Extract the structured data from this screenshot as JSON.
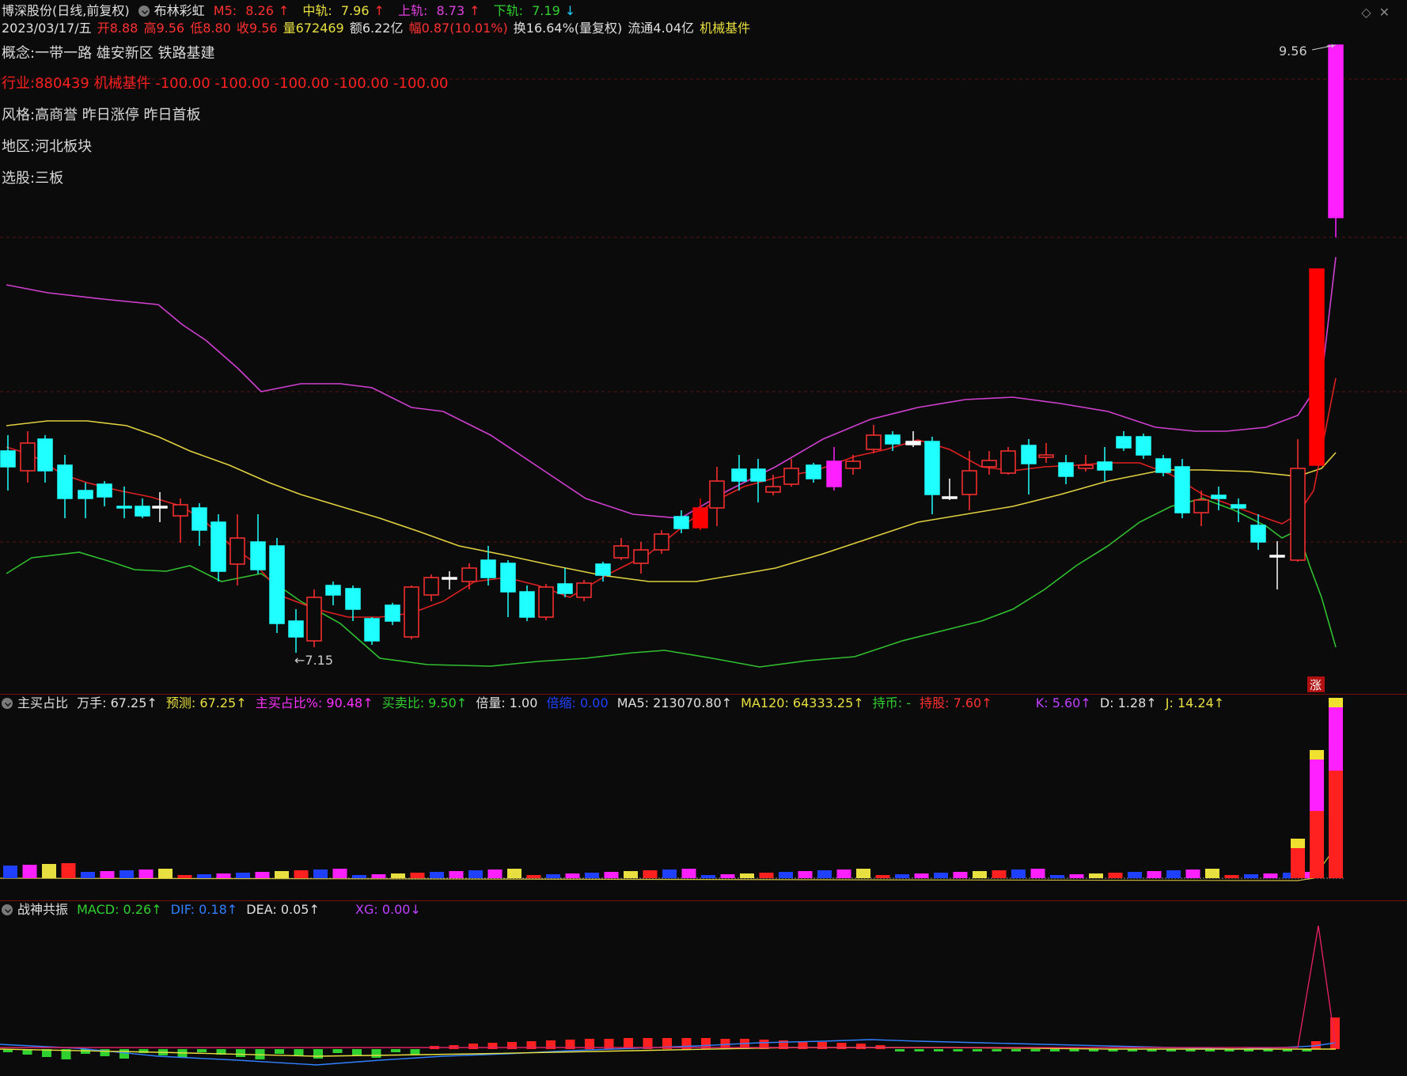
{
  "header": {
    "stock_title": "博深股份(日线,前复权)",
    "indicator_name": "布林彩虹",
    "m5": {
      "label": "M5:",
      "value": "8.26",
      "arrow": "↑"
    },
    "mid": {
      "label": "中轨:",
      "value": "7.96",
      "arrow": "↑"
    },
    "upper": {
      "label": "上轨:",
      "value": "8.73",
      "arrow": "↑"
    },
    "lower": {
      "label": "下轨:",
      "value": "7.19",
      "arrow": "↓"
    }
  },
  "quote_line": {
    "date": "2023/03/17/五",
    "open": "开8.88",
    "high": "高9.56",
    "low": "低8.80",
    "close": "收9.56",
    "volume": "量672469",
    "amount": "额6.22亿",
    "change": "幅0.87(10.01%)",
    "turnover": "换16.64%(量复权)",
    "float_cap": "流通4.04亿",
    "industry_tag": "机械基件"
  },
  "info": {
    "concept": {
      "label": "概念:",
      "value": "一带一路 雄安新区 铁路基建"
    },
    "industry": {
      "label": "行业:",
      "value": "880439 机械基件 -100.00 -100.00 -100.00 -100.00 -100.00"
    },
    "style": {
      "label": "风格:",
      "value": "高商誉 昨日涨停 昨日首板"
    },
    "region": {
      "label": "地区:",
      "value": "河北板块"
    },
    "pick": {
      "label": "选股:",
      "value": "三板"
    }
  },
  "price_labels": {
    "high_mark": "9.56",
    "low_mark": "←7.15",
    "limit_badge": "涨"
  },
  "panel2": {
    "title": "主买占比",
    "wanshou": "万手: 67.25↑",
    "forecast": "预测: 67.25↑",
    "main_buy_pct": "主买占比%: 90.48↑",
    "buy_sell_ratio": "买卖比: 9.50↑",
    "multiple": "倍量: 1.00",
    "shrink": "倍缩: 0.00",
    "ma5": "MA5: 213070.80↑",
    "ma120": "MA120: 64333.25↑",
    "hold_coin": "持币: -",
    "hold_stock": "持股: 7.60↑",
    "k": "K: 5.60↑",
    "d": "D: 1.28↑",
    "j": "J: 14.24↑"
  },
  "panel3": {
    "title": "战神共振",
    "macd": "MACD: 0.26↑",
    "dif": "DIF: 0.18↑",
    "dea": "DEA: 0.05↑",
    "xg": "XG: 0.00↓"
  },
  "colors": {
    "up": "#ff2020",
    "down": "#20ffff",
    "upper_band": "#d040d0",
    "mid_band": "#e0d040",
    "lower_band": "#30c030",
    "ma5": "#e02020",
    "limit_candle": "#ff20ff"
  }
}
